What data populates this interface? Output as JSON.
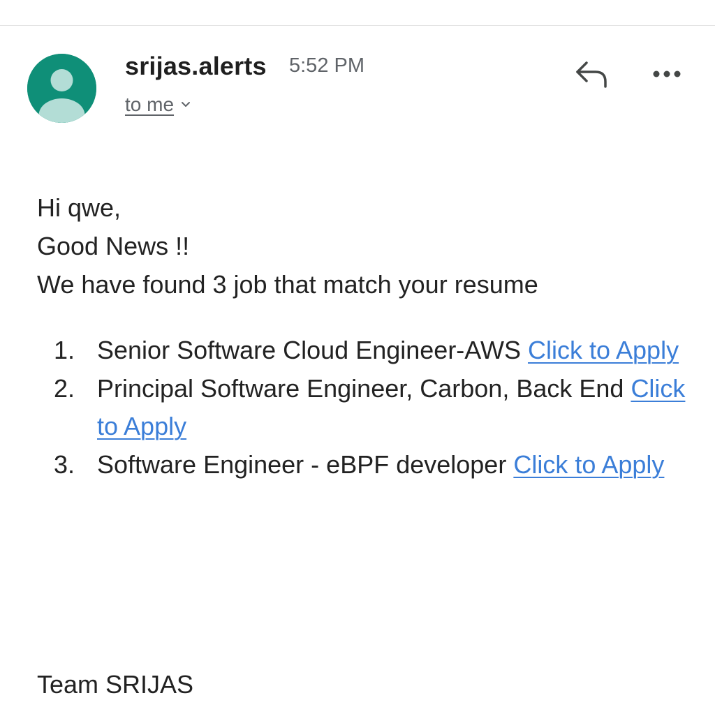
{
  "header": {
    "sender": "srijas.alerts",
    "time": "5:52 PM",
    "recipient": "to me",
    "avatar_color": "#0f8f78",
    "icons": [
      "person-icon",
      "chevron-down-icon",
      "reply-icon",
      "more-icon"
    ]
  },
  "message": {
    "greeting": "Hi qwe,",
    "headline": "Good News !!",
    "intro": "We have found 3 job that match your resume",
    "jobs": [
      {
        "number": "1.",
        "title": "Senior Software Cloud Engineer-AWS",
        "link": "Click to Apply"
      },
      {
        "number": "2.",
        "title": "Principal Software Engineer, Carbon, Back End",
        "link": "Click to Apply"
      },
      {
        "number": "3.",
        "title": "Software Engineer - eBPF developer",
        "link": "Click to Apply"
      }
    ],
    "signature": "Team SRIJAS",
    "link_color": "#3b7ed8"
  }
}
